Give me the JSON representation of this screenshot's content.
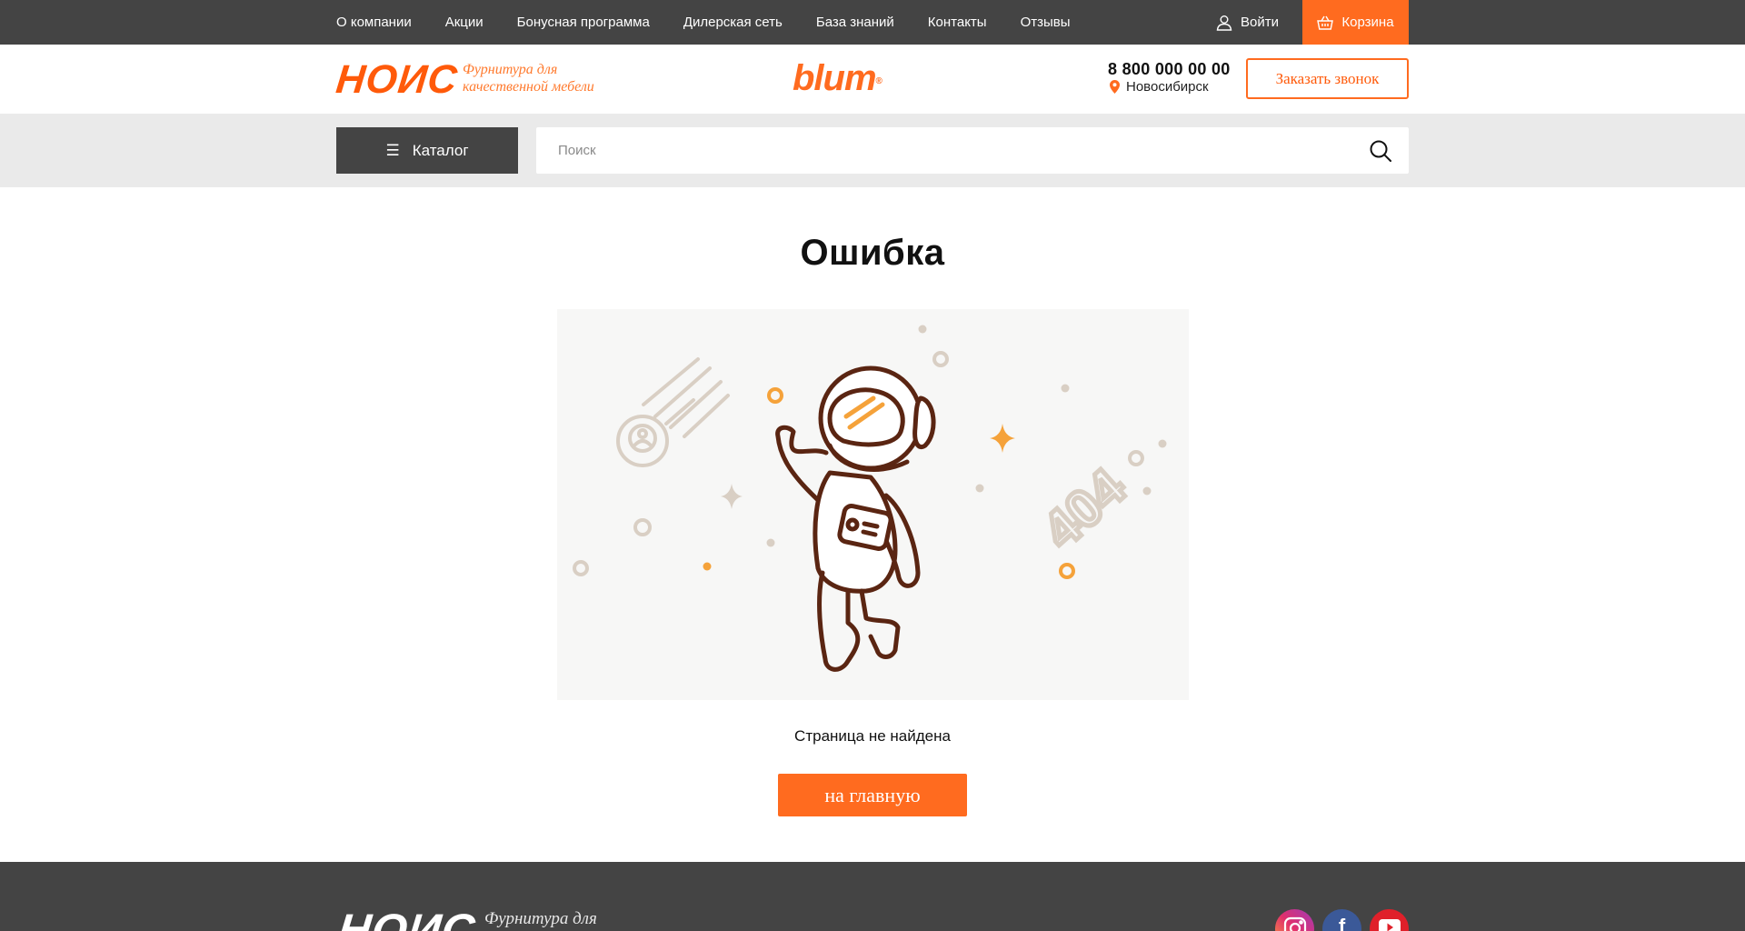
{
  "topbar": {
    "nav": [
      "О компании",
      "Акции",
      "Бонусная программа",
      "Дилерская сеть",
      "База знаний",
      "Контакты",
      "Отзывы"
    ],
    "login_label": "Войти",
    "cart_label": "Корзина"
  },
  "header": {
    "logo_text": "НОИС",
    "tagline": "Фурнитура для качественной мебели",
    "brand_logo": "blum",
    "brand_reg": "®",
    "phone": "8 800 000 00 00",
    "city": "Новосибирск",
    "callback_label": "Заказать звонок"
  },
  "searchbar": {
    "catalog_label": "Каталог",
    "search_placeholder": "Поиск"
  },
  "main": {
    "title": "Ошибка",
    "illustration_text": "404",
    "message": "Страница не найдена",
    "home_button_label": "на главную"
  },
  "footer": {
    "logo_text": "НОИС",
    "tagline": "Фурнитура для",
    "social": [
      "instagram-icon",
      "facebook-icon",
      "youtube-icon"
    ]
  },
  "colors": {
    "accent": "#ff6b1f",
    "dark_bar": "#444444",
    "search_bg": "#eaeaea"
  }
}
